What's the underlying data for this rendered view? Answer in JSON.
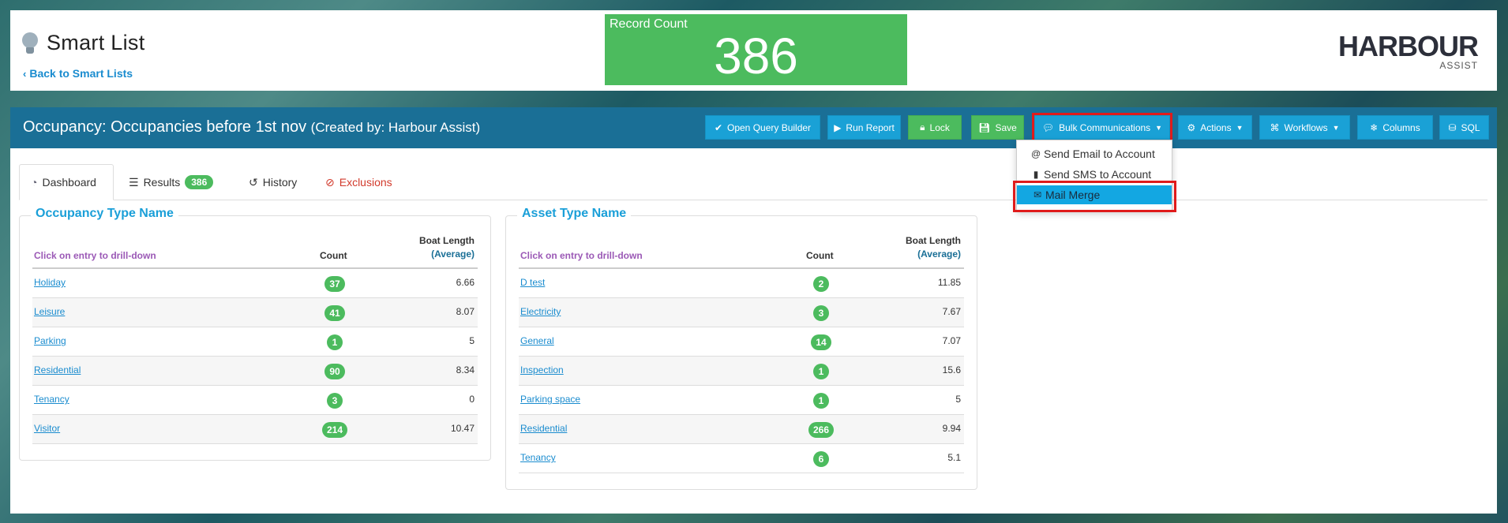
{
  "header": {
    "title": "Smart List",
    "back_link": "Back to Smart Lists",
    "record_count_label": "Record Count",
    "record_count_value": "386",
    "logo_main": "HARBOUR",
    "logo_sub": "ASSIST"
  },
  "panel": {
    "title": "Occupancy: Occupancies before 1st nov",
    "creator": "(Created by: Harbour Assist)"
  },
  "toolbar": {
    "open_query_builder": "Open Query Builder",
    "run_report": "Run Report",
    "lock": "Lock",
    "save": "Save",
    "bulk_communications": "Bulk Communications",
    "actions": "Actions",
    "workflows": "Workflows",
    "columns": "Columns",
    "sql": "SQL"
  },
  "dropdown": {
    "items": [
      "Send Email to Account",
      "Send SMS to Account",
      "Mail Merge"
    ],
    "active_index": 2
  },
  "tabs": {
    "dashboard": "Dashboard",
    "results": "Results",
    "results_count": "386",
    "history": "History",
    "exclusions": "Exclusions"
  },
  "occupancy_card": {
    "title": "Occupancy Type Name",
    "hint": "Click on entry to drill-down",
    "col_count": "Count",
    "col_len_line1": "Boat Length",
    "col_len_line2": "(Average)",
    "rows": [
      {
        "name": "Holiday",
        "count": "37",
        "length": "6.66"
      },
      {
        "name": "Leisure",
        "count": "41",
        "length": "8.07"
      },
      {
        "name": "Parking",
        "count": "1",
        "length": "5"
      },
      {
        "name": "Residential",
        "count": "90",
        "length": "8.34"
      },
      {
        "name": "Tenancy",
        "count": "3",
        "length": "0"
      },
      {
        "name": "Visitor",
        "count": "214",
        "length": "10.47"
      }
    ]
  },
  "asset_card": {
    "title": "Asset Type Name",
    "hint": "Click on entry to drill-down",
    "col_count": "Count",
    "col_len_line1": "Boat Length",
    "col_len_line2": "(Average)",
    "rows": [
      {
        "name": "D test",
        "count": "2",
        "length": "11.85"
      },
      {
        "name": "Electricity",
        "count": "3",
        "length": "7.67"
      },
      {
        "name": "General",
        "count": "14",
        "length": "7.07"
      },
      {
        "name": "Inspection",
        "count": "1",
        "length": "15.6"
      },
      {
        "name": "Parking space",
        "count": "1",
        "length": "5"
      },
      {
        "name": "Residential",
        "count": "266",
        "length": "9.94"
      },
      {
        "name": "Tenancy",
        "count": "6",
        "length": "5.1"
      }
    ]
  },
  "colors": {
    "header_bar": "#1a6f96",
    "button_blue": "#1aa1d6",
    "badge_green": "#4cbb5e",
    "highlight_red": "#e01b1b",
    "link_blue": "#1a8ccf"
  }
}
